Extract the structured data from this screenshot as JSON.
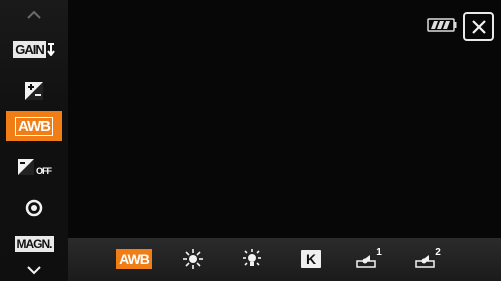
{
  "sidebar": {
    "items": [
      {
        "name": "gain",
        "label": "GAIN"
      },
      {
        "name": "exposure",
        "label": ""
      },
      {
        "name": "white-balance",
        "label": "AWB"
      },
      {
        "name": "exposure-off",
        "label": "OFF"
      },
      {
        "name": "focus",
        "label": ""
      },
      {
        "name": "magnify",
        "label": "MAGN."
      }
    ]
  },
  "bottom": {
    "items": [
      {
        "name": "awb",
        "label": "AWB",
        "selected": true
      },
      {
        "name": "daylight",
        "label": ""
      },
      {
        "name": "tungsten",
        "label": ""
      },
      {
        "name": "kelvin",
        "label": "K"
      },
      {
        "name": "custom1",
        "label": "1"
      },
      {
        "name": "custom2",
        "label": "2"
      }
    ]
  },
  "status": {
    "battery": "battery-icon"
  },
  "colors": {
    "accent": "#f07d16"
  }
}
